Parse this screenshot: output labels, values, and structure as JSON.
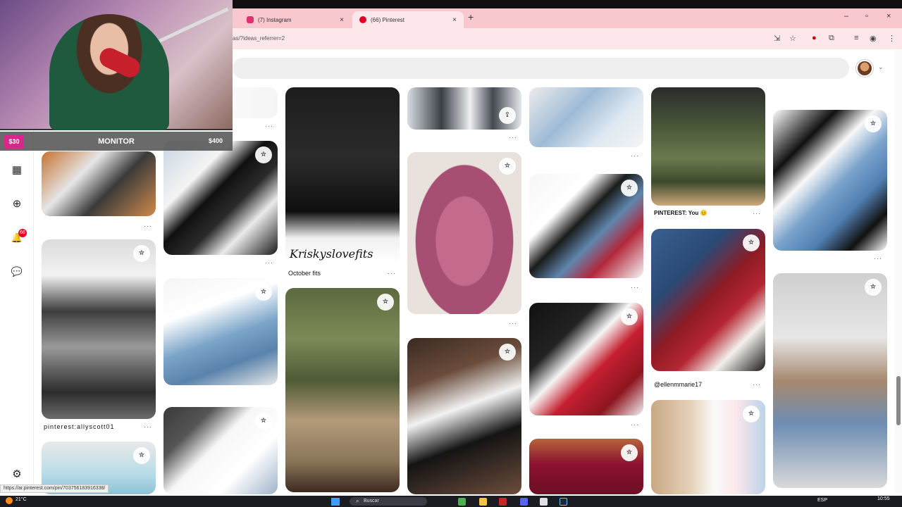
{
  "browser": {
    "tabs": [
      {
        "title": "(7) Instagram",
        "favicon_color": "#e1306c"
      },
      {
        "title": "(66) Pinterest",
        "favicon_color": "#e60023"
      }
    ],
    "new_tab_glyph": "+",
    "close_glyph": "×",
    "window_controls": [
      "–",
      "▫",
      "×"
    ],
    "url": "as/?ideas_referrer=2"
  },
  "sidebar": {
    "items": [
      {
        "name": "dashboard-icon",
        "glyph": "▦"
      },
      {
        "name": "create-icon",
        "glyph": "⊕"
      },
      {
        "name": "notifications-icon",
        "glyph": "🔔"
      },
      {
        "name": "messages-icon",
        "glyph": "💬"
      },
      {
        "name": "settings-icon",
        "glyph": "⚙"
      }
    ],
    "notification_count": "66"
  },
  "overlay": {
    "monitor_label": "MONITOR",
    "cost_left": "$30",
    "cost_right": "$400"
  },
  "pins": {
    "save_glyph": "✮",
    "captions": {
      "october": "October fits",
      "pinterest_you": "PINTEREST: You 😊",
      "ellenmmarie": "@ellenmmarie17",
      "allyscott": "pinterest:allyscott01",
      "krisky": "Kriskyslovefits"
    }
  },
  "status_link": "https://ar.pinterest.com/pin/703756183916338/",
  "taskbar": {
    "weather": "21°C",
    "search_placeholder": "Buscar",
    "language": "ESP",
    "time": "10:55"
  }
}
